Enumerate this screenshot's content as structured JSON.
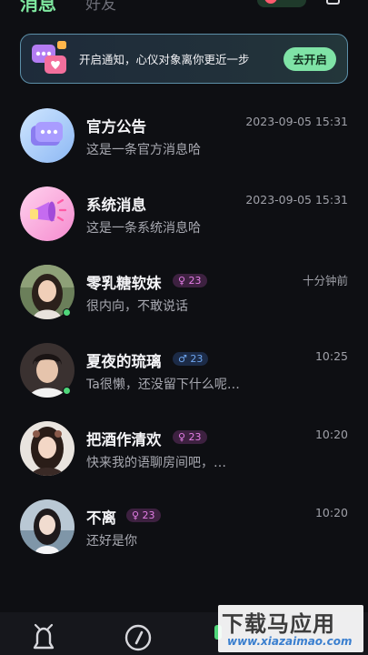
{
  "tabs": [
    {
      "label": "消息",
      "active": true
    },
    {
      "label": "好友",
      "active": false
    }
  ],
  "banner": {
    "text": "开启通知，心仪对象离你更近一步",
    "button_label": "去开启"
  },
  "conversations": [
    {
      "name": "官方公告",
      "message": "这是一条官方消息哈",
      "time": "2023-09-05  15:31",
      "avatar_icon": "chat-bubble-icon",
      "online": false
    },
    {
      "name": "系统消息",
      "message": "这是一条系统消息哈",
      "time": "2023-09-05  15:31",
      "avatar_icon": "megaphone-icon",
      "online": false
    },
    {
      "name": "零乳糖软妹",
      "message": "很内向，不敢说话",
      "time": "十分钟前",
      "gender": "female",
      "age": "23",
      "badge": "♀ 23",
      "online": true
    },
    {
      "name": "夏夜的琉璃",
      "message": "Ta很懒，还没留下什么呢…",
      "time": "10:25",
      "gender": "male",
      "age": "23",
      "badge": "♂ 23",
      "online": true
    },
    {
      "name": "把酒作清欢",
      "message": "快来我的语聊房间吧，…",
      "time": "10:20",
      "gender": "female",
      "age": "23",
      "badge": "♀ 23",
      "online": false
    },
    {
      "name": "不离",
      "message": "还好是你",
      "time": "10:20",
      "gender": "female",
      "age": "23",
      "badge": "♀ 23",
      "online": false
    }
  ],
  "bottom_nav": [
    {
      "icon": "bell-icon"
    },
    {
      "icon": "compass-icon"
    },
    {
      "icon": "message-icon"
    },
    {
      "icon": "profile-icon"
    }
  ],
  "watermark": {
    "title": "下载马应用",
    "url": "www.xiazaimao.com"
  },
  "colors": {
    "background": "#0e0f13",
    "accent": "#7fe3a6",
    "female_badge": "#e47ee6",
    "male_badge": "#6fa6ef",
    "online": "#4fd77a"
  }
}
